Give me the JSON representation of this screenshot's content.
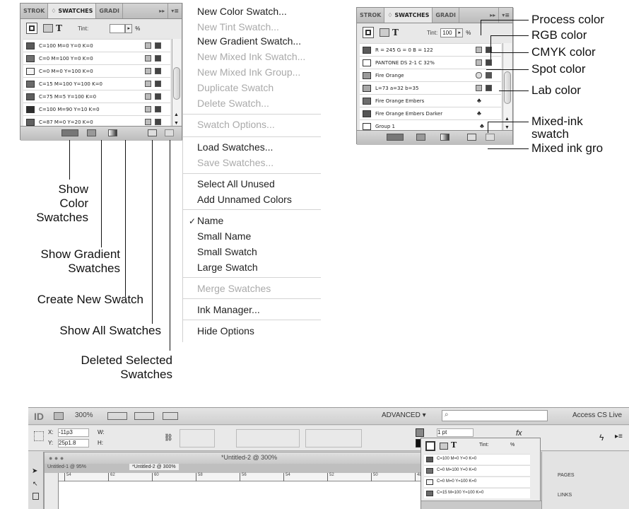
{
  "left_panel": {
    "tabs": [
      "STROK",
      "♢ SWATCHES",
      "GRADI",
      "▸▸",
      "▾≡"
    ],
    "tint_label": "Tint:",
    "tint_value": "",
    "tint_arrow": "▸",
    "percent": "%",
    "stroke_T": "T",
    "swatches": [
      {
        "name": "C=100 M=0 Y=0 K=0",
        "color": "#5a5a5a"
      },
      {
        "name": "C=0 M=100 Y=0 K=0",
        "color": "#707070"
      },
      {
        "name": "C=0 M=0 Y=100 K=0",
        "color": "#f4f4f4"
      },
      {
        "name": "C=15 M=100 Y=100 K=0",
        "color": "#6a6a6a"
      },
      {
        "name": "C=75 M=5 Y=100 K=0",
        "color": "#5e5e5e"
      },
      {
        "name": "C=100 M=90 Y=10 K=0",
        "color": "#2e2e2e"
      },
      {
        "name": "C=87 M=0 Y=20 K=0",
        "color": "#626262"
      }
    ]
  },
  "menu": {
    "items": [
      {
        "label": "New Color Swatch...",
        "enabled": true
      },
      {
        "label": "New Tint Swatch...",
        "enabled": false
      },
      {
        "label": "New Gradient Swatch...",
        "enabled": true
      },
      {
        "label": "New Mixed Ink Swatch...",
        "enabled": false
      },
      {
        "label": "New Mixed Ink Group...",
        "enabled": false
      },
      {
        "label": "Duplicate Swatch",
        "enabled": false
      },
      {
        "label": "Delete Swatch...",
        "enabled": false
      },
      {
        "label": "Swatch Options...",
        "enabled": false
      },
      {
        "label": "Load Swatches...",
        "enabled": true
      },
      {
        "label": "Save Swatches...",
        "enabled": false
      },
      {
        "label": "Select All Unused",
        "enabled": true
      },
      {
        "label": "Add Unnamed Colors",
        "enabled": true
      },
      {
        "label": "Name",
        "enabled": true,
        "checked": true
      },
      {
        "label": "Small Name",
        "enabled": true
      },
      {
        "label": "Small Swatch",
        "enabled": true
      },
      {
        "label": "Large Swatch",
        "enabled": true
      },
      {
        "label": "Merge Swatches",
        "enabled": false
      },
      {
        "label": "Ink Manager...",
        "enabled": true
      },
      {
        "label": "Hide Options",
        "enabled": true
      }
    ],
    "checkmark": "✓"
  },
  "left_callouts": {
    "show_color": "Show\nColor\nSwatches",
    "show_gradient": "Show Gradient\nSwatches",
    "create_new": "Create New Swatch",
    "show_all": "Show All Swatches",
    "delete": "Deleted Selected\nSwatches"
  },
  "right_panel": {
    "tabs": [
      "STROK",
      "♢ SWATCHES",
      "GRADI",
      "▸▸",
      "▾≡"
    ],
    "tint_label": "Tint:",
    "tint_value": "100",
    "tint_arrow": "▸",
    "percent": "%",
    "stroke_T": "T",
    "swatches": [
      {
        "name": "R = 245 G = 0 B = 122",
        "color": "#5a5a5a"
      },
      {
        "name": "PANTONE DS 2-1 C 32%",
        "color": "#ffffff"
      },
      {
        "name": "Fire Orange",
        "color": "#9a9a9a"
      },
      {
        "name": "L=73 a=32 b=35",
        "color": "#a8a8a8"
      },
      {
        "name": "Fire Orange Embers",
        "color": "#6e6e6e"
      },
      {
        "name": "Fire Orange Embers Darker",
        "color": "#555555"
      },
      {
        "name": "Group 1",
        "color": "#ffffff"
      }
    ]
  },
  "right_callouts": [
    "Process color",
    "RGB color",
    "CMYK color",
    "Spot color",
    "Lab color",
    "Mixed-ink\nswatch",
    "Mixed ink gro"
  ],
  "app": {
    "logo": "ID",
    "zoom": "300%",
    "workspace": "ADVANCED ▾",
    "access": "Access CS Live",
    "doc_title": "*Untitled-2 @ 300%",
    "tab1": "Untitled-1 @ 95%",
    "tab2": "*Untitled-2 @ 300%",
    "x_label": "X:",
    "x_value": "-11p3",
    "y_label": "Y:",
    "y_value": "25p1.8",
    "w_label": "W:",
    "h_label": "H:",
    "stroke_weight": "1 pt",
    "panel_pages": "PAGES",
    "panel_links": "LINKS",
    "mini_tint": "Tint:",
    "mini_pct": "%",
    "mini_swatches": [
      {
        "name": "C=100 M=0 Y=0 K=0",
        "color": "#5a5a5a"
      },
      {
        "name": "C=0 M=100 Y=0 K=0",
        "color": "#707070"
      },
      {
        "name": "C=0 M=0 Y=100 K=0",
        "color": "#f4f4f4"
      },
      {
        "name": "C=15 M=100 Y=100 K=0",
        "color": "#6a6a6a"
      }
    ],
    "ruler": [
      "54",
      "62",
      "60",
      "58",
      "56",
      "54",
      "52",
      "50",
      "48"
    ]
  }
}
